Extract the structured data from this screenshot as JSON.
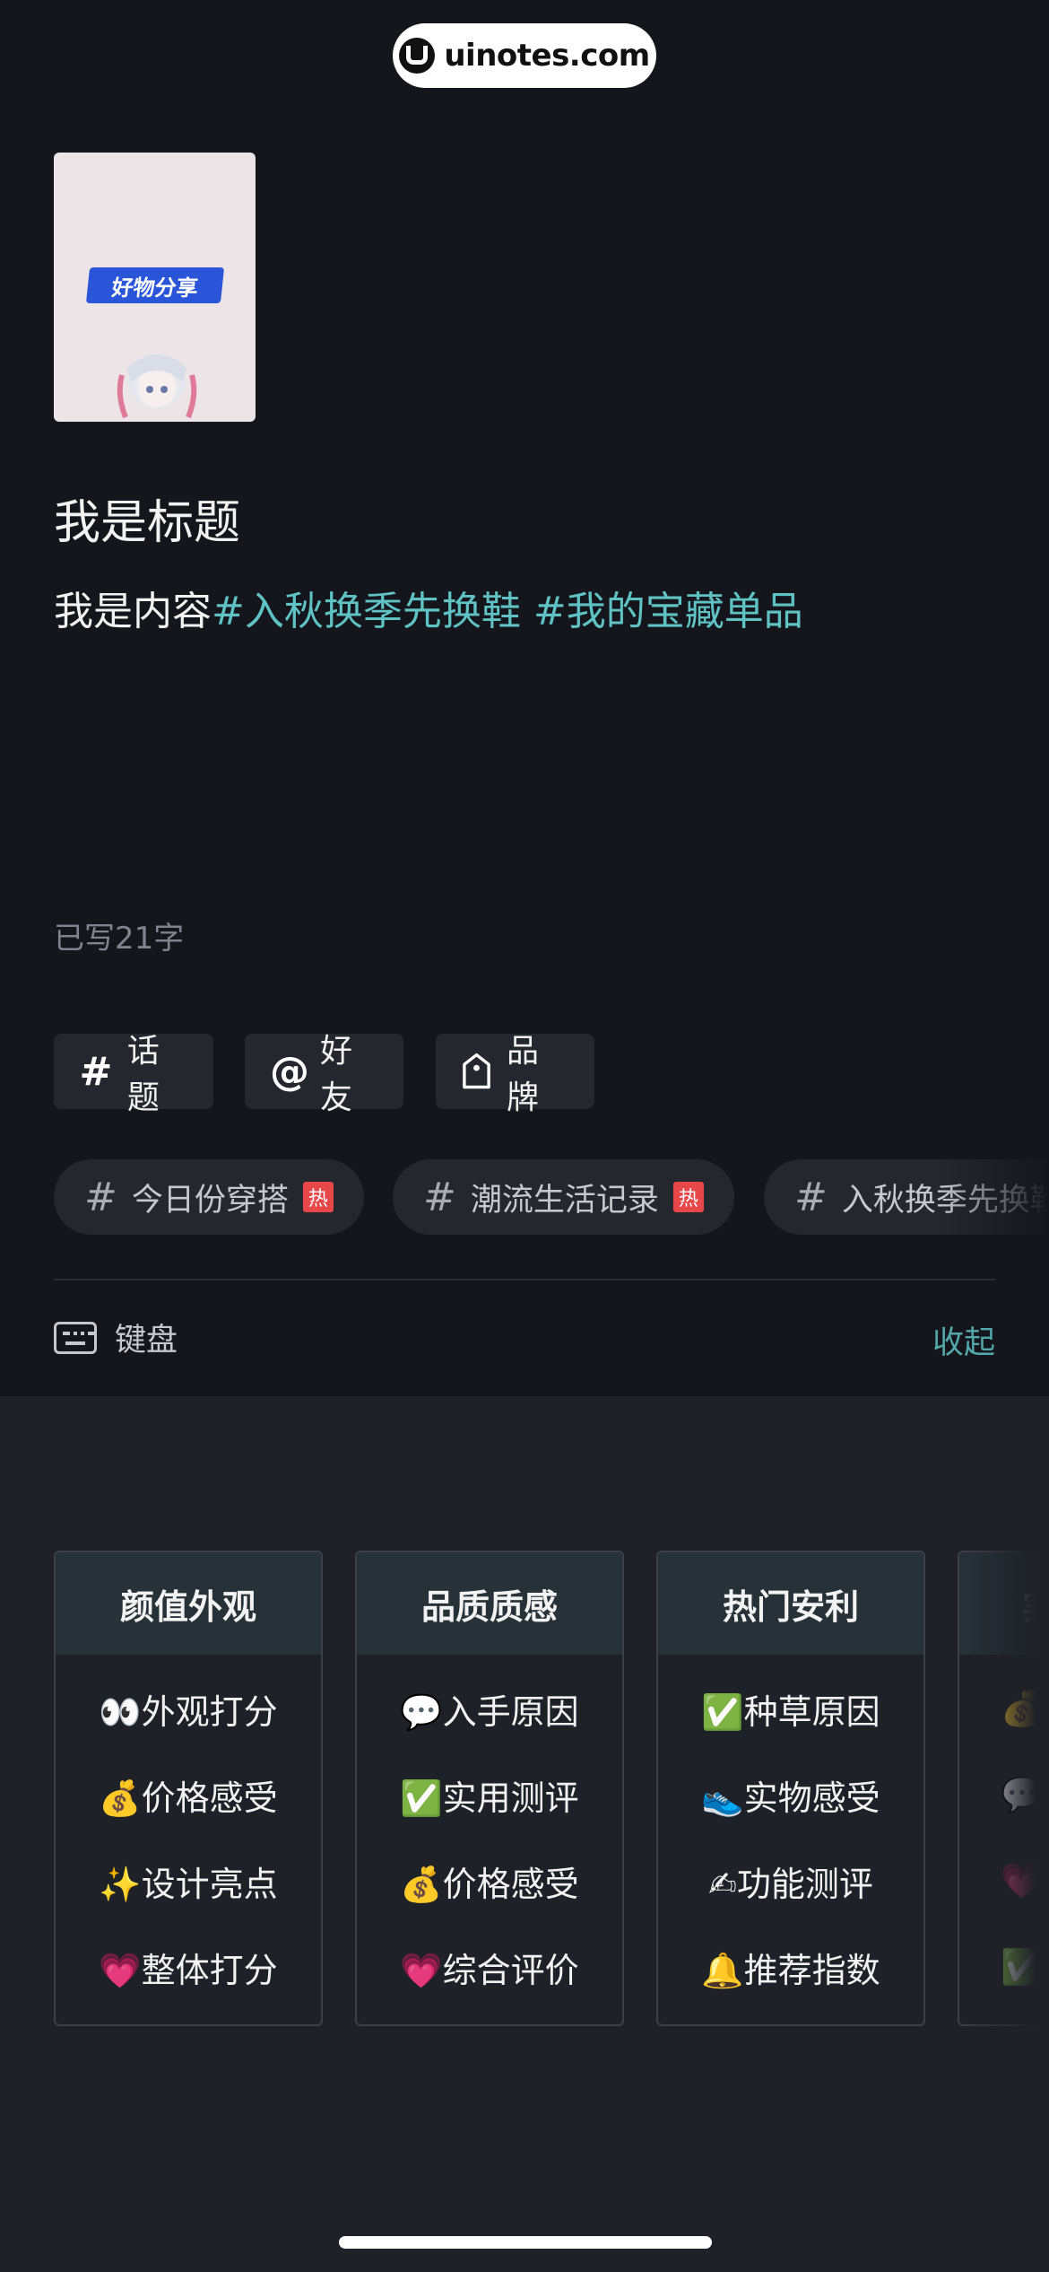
{
  "watermark": {
    "text": "uinotes.com"
  },
  "cover": {
    "banner_text": "好物分享"
  },
  "post": {
    "title": "我是标题",
    "content_prefix": "我是内容",
    "hashtags": [
      "#入秋换季先换鞋",
      "#我的宝藏单品"
    ],
    "char_count": "已写21字"
  },
  "toolbar": [
    {
      "icon": "hash-icon",
      "glyph": "#",
      "label": "话题"
    },
    {
      "icon": "at-icon",
      "glyph": "@",
      "label": "好友"
    },
    {
      "icon": "tag-icon",
      "glyph": "⌂",
      "label": "品牌"
    }
  ],
  "suggested_topics": [
    {
      "label": "今日份穿搭",
      "badge": "热"
    },
    {
      "label": "潮流生活记录",
      "badge": "热"
    },
    {
      "label": "入秋换季先换鞋",
      "badge": ""
    }
  ],
  "keyboard_bar": {
    "label": "键盘",
    "collapse": "收起"
  },
  "templates": [
    {
      "title": "颜值外观",
      "items": [
        "👀外观打分",
        "💰价格感受",
        "✨设计亮点",
        "💗整体打分"
      ]
    },
    {
      "title": "品质质感",
      "items": [
        "💬入手原因",
        "✅实用测评",
        "💰价格感受",
        "💗综合评价"
      ]
    },
    {
      "title": "热门安利",
      "items": [
        "✅种草原因",
        "👟实物感受",
        "✍功能测评",
        "🔔推荐指数"
      ]
    },
    {
      "title": "实",
      "items": [
        "💰",
        "💬",
        "💗",
        "✅"
      ]
    }
  ]
}
